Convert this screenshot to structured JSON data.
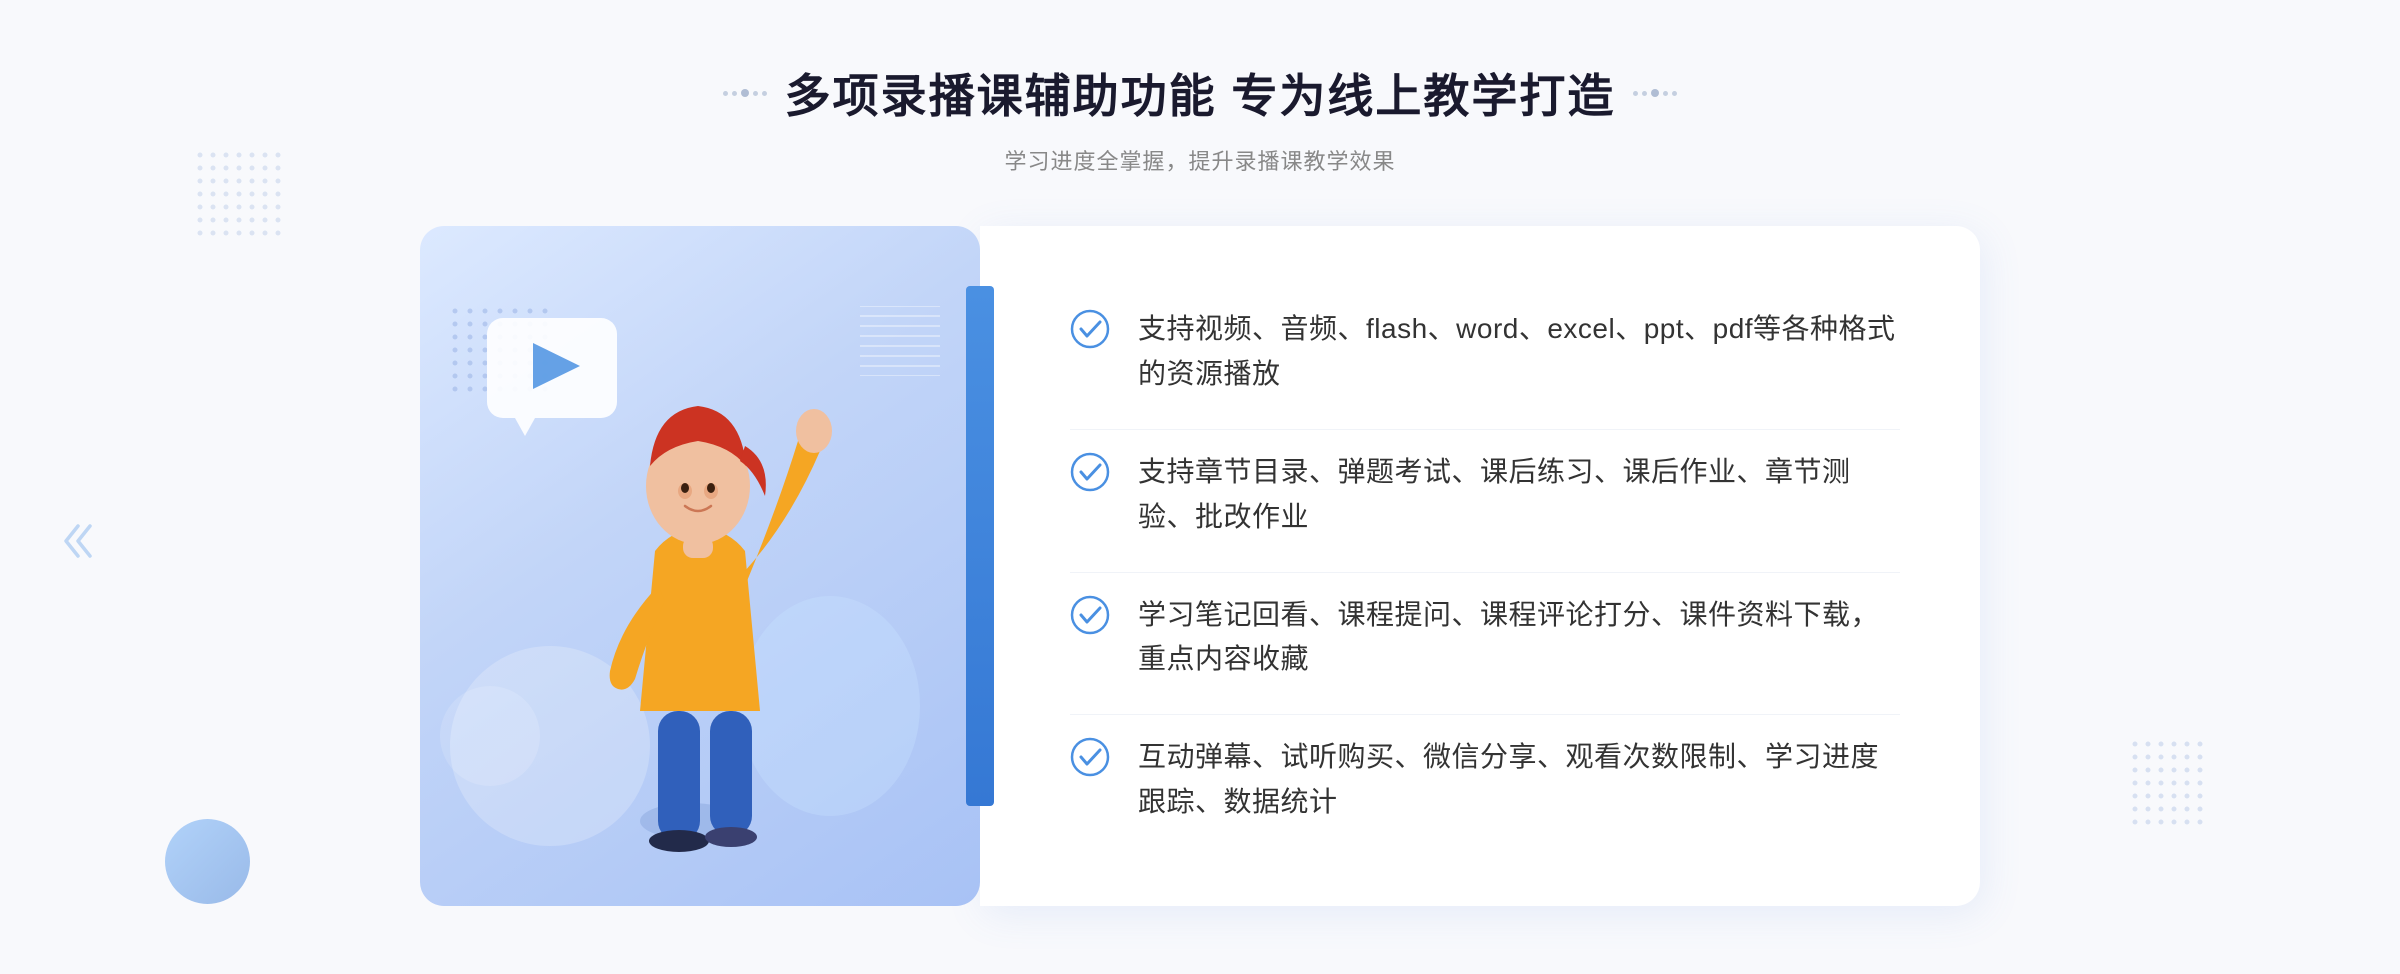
{
  "header": {
    "title": "多项录播课辅助功能 专为线上教学打造",
    "subtitle": "学习进度全掌握，提升录播课教学效果"
  },
  "features": [
    {
      "id": "feature-1",
      "text": "支持视频、音频、flash、word、excel、ppt、pdf等各种格式的资源播放"
    },
    {
      "id": "feature-2",
      "text": "支持章节目录、弹题考试、课后练习、课后作业、章节测验、批改作业"
    },
    {
      "id": "feature-3",
      "text": "学习笔记回看、课程提问、课程评论打分、课件资料下载，重点内容收藏"
    },
    {
      "id": "feature-4",
      "text": "互动弹幕、试听购买、微信分享、观看次数限制、学习进度跟踪、数据统计"
    }
  ],
  "decorative": {
    "chevron_left": "»",
    "accent_color": "#4a90e2"
  }
}
